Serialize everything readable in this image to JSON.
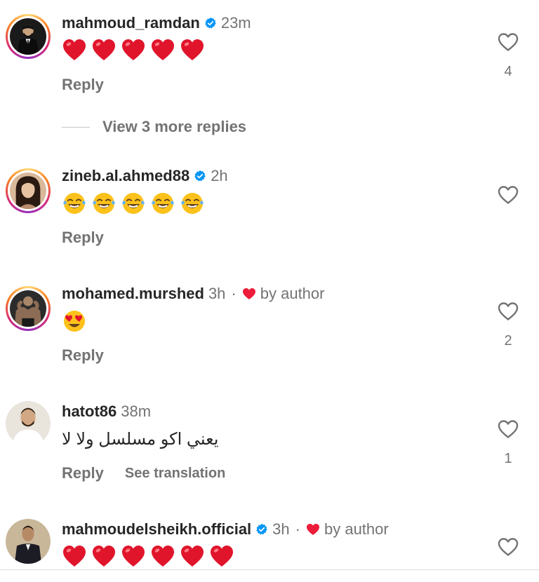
{
  "colors": {
    "username": "#262626",
    "secondary": "#737373",
    "verified": "#0095f6",
    "author_heart": "#ed1c3a",
    "background": "#ffffff"
  },
  "labels": {
    "reply": "Reply",
    "see_translation": "See translation",
    "by_author": "by author",
    "separator": "·"
  },
  "view_more_replies": "View 3 more replies",
  "comments": [
    {
      "username": "mahmoud_ramdan",
      "verified": true,
      "time": "23m",
      "liked_by_author": false,
      "emoji": [
        "red-heart",
        "red-heart",
        "red-heart",
        "red-heart",
        "red-heart"
      ],
      "like_count": "4"
    },
    {
      "username": "zineb.al.ahmed88",
      "verified": true,
      "time": "2h",
      "liked_by_author": false,
      "emoji": [
        "tears-of-joy",
        "tears-of-joy",
        "tears-of-joy",
        "tears-of-joy",
        "tears-of-joy"
      ],
      "like_count": ""
    },
    {
      "username": "mohamed.murshed",
      "verified": false,
      "time": "3h",
      "liked_by_author": true,
      "emoji": [
        "heart-eyes"
      ],
      "like_count": "2"
    },
    {
      "username": "hatot86",
      "verified": false,
      "time": "38m",
      "liked_by_author": false,
      "text": "يعني اكو مسلسل ولا لا",
      "show_translation": true,
      "like_count": "1"
    },
    {
      "username": "mahmoudelsheikh.official",
      "verified": true,
      "time": "3h",
      "liked_by_author": true,
      "emoji": [
        "red-heart",
        "red-heart",
        "red-heart",
        "red-heart",
        "red-heart",
        "red-heart"
      ],
      "like_count": ""
    }
  ]
}
